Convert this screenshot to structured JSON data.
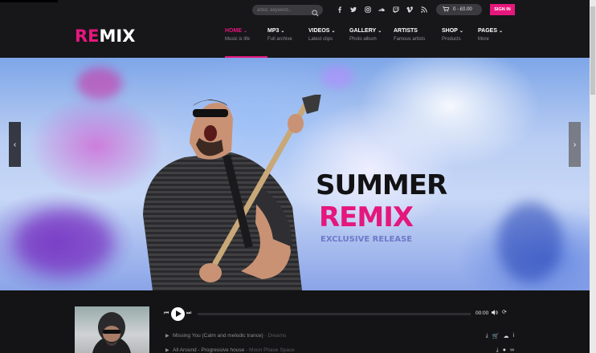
{
  "header": {
    "search": {
      "placeholder": "artist, keyword..."
    },
    "socials": [
      "facebook-icon",
      "twitter-icon",
      "instagram-icon",
      "soundcloud-icon",
      "twitch-icon",
      "vimeo-icon",
      "rss-icon"
    ],
    "cart": {
      "label": "0 - £0.00"
    },
    "signin": {
      "label": "SIGN IN"
    },
    "logo": {
      "part1": "RE",
      "part2": "MIX"
    },
    "nav": [
      {
        "title": "HOME",
        "sub": "Music is life",
        "dropdown": true,
        "active": true
      },
      {
        "title": "MP3",
        "sub": "Full archive",
        "dropdown": true
      },
      {
        "title": "VIDEOS",
        "sub": "Latest clips",
        "dropdown": true
      },
      {
        "title": "GALLERY",
        "sub": "Photo album",
        "dropdown": true
      },
      {
        "title": "ARTISTS",
        "sub": "Famous artists",
        "dropdown": false
      },
      {
        "title": "SHOP",
        "sub": "Products",
        "dropdown": true
      },
      {
        "title": "PAGES",
        "sub": "More",
        "dropdown": true
      }
    ]
  },
  "hero": {
    "title_line1": "SUMMER",
    "title_line2": "REMIX",
    "subtitle": "EXCLUSIVE RELEASE"
  },
  "player": {
    "time": "00:00",
    "progress": 0,
    "tracks": [
      {
        "title": "Missing You (Calm and melodic trance)",
        "separator": " - ",
        "artist": "Dreams"
      },
      {
        "title": "All Around - Progressive house",
        "separator": " - ",
        "artist": "Moon Phase Space"
      }
    ]
  },
  "colors": {
    "accent": "#e5177c",
    "header_bg": "#17171a",
    "section_bg": "#141416"
  }
}
